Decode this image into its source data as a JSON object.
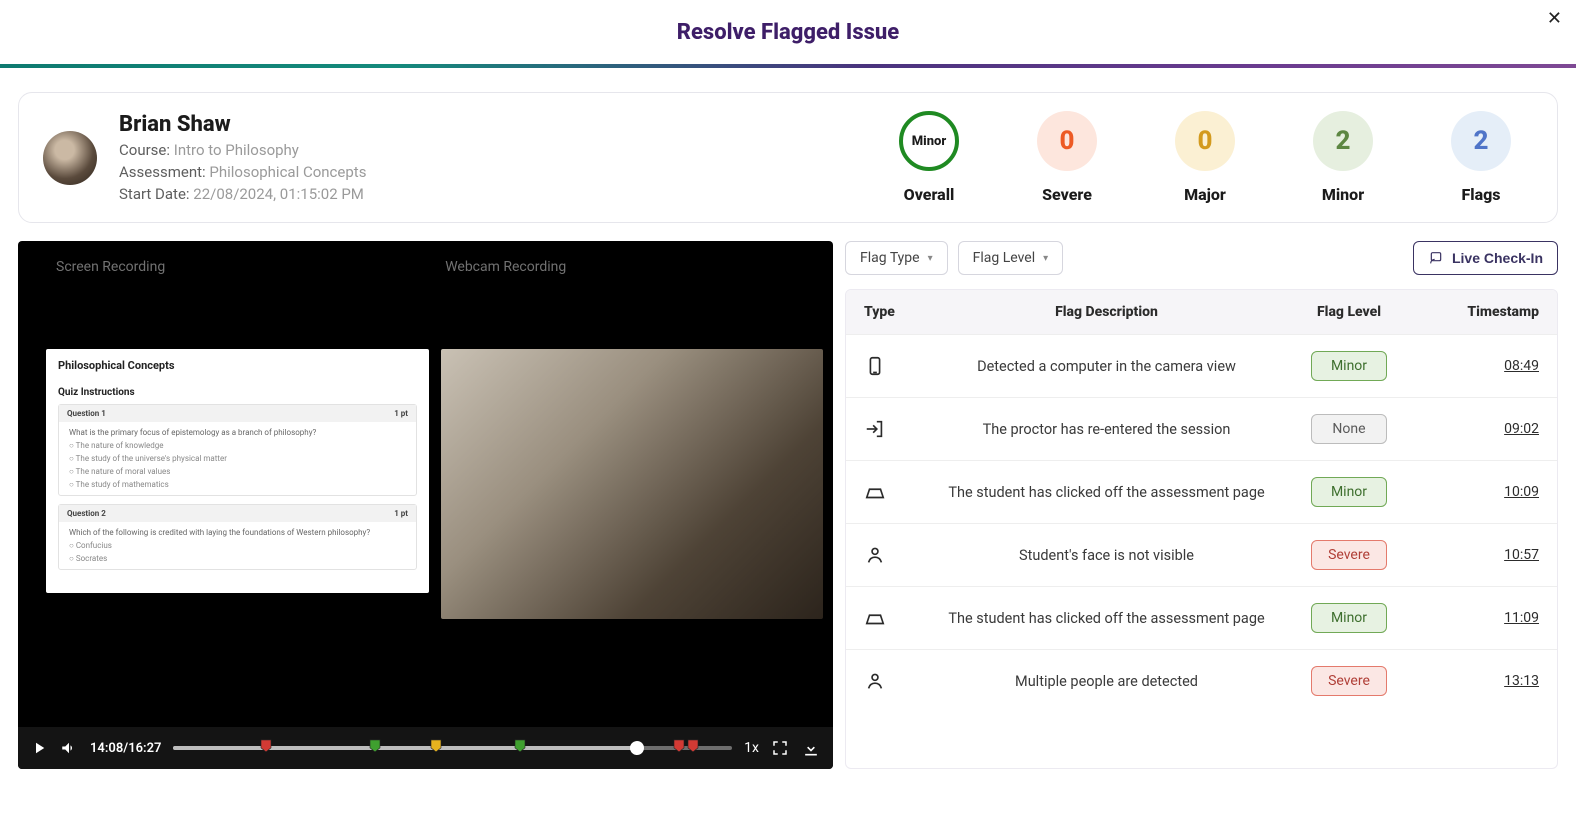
{
  "header": {
    "title": "Resolve Flagged Issue"
  },
  "student": {
    "name": "Brian Shaw",
    "course_label": "Course:",
    "course_value": "Intro to Philosophy",
    "assessment_label": "Assessment:",
    "assessment_value": "Philosophical Concepts",
    "start_label": "Start Date:",
    "start_value": "22/08/2024, 01:15:02 PM"
  },
  "stats": {
    "overall": {
      "text": "Minor",
      "label": "Overall"
    },
    "severe": {
      "value": "0",
      "label": "Severe"
    },
    "major": {
      "value": "0",
      "label": "Major"
    },
    "minor": {
      "value": "2",
      "label": "Minor"
    },
    "flags": {
      "value": "2",
      "label": "Flags"
    }
  },
  "video": {
    "screen_label": "Screen Recording",
    "webcam_label": "Webcam Recording",
    "quiz_title": "Philosophical Concepts",
    "quiz_instr": "Quiz Instructions",
    "q1": "Question 1",
    "q2": "Question 2",
    "pts": "1 pt",
    "time": "14:08/16:27",
    "speed": "1x",
    "markers": [
      {
        "pct": 16.5,
        "color": "#d23a34"
      },
      {
        "pct": 36.0,
        "color": "#3fa02f"
      },
      {
        "pct": 47.0,
        "color": "#e6b21f"
      },
      {
        "pct": 62.0,
        "color": "#3fa02f"
      },
      {
        "pct": 90.5,
        "color": "#d23a34"
      },
      {
        "pct": 93.0,
        "color": "#d23a34"
      }
    ]
  },
  "filters": {
    "type_label": "Flag Type",
    "level_label": "Flag Level",
    "live_label": "Live Check-In"
  },
  "table": {
    "headers": {
      "type": "Type",
      "desc": "Flag Description",
      "level": "Flag Level",
      "ts": "Timestamp"
    },
    "rows": [
      {
        "icon": "device",
        "desc": "Detected a computer in the camera view",
        "level": "Minor",
        "level_cls": "minor",
        "ts": "08:49"
      },
      {
        "icon": "enter",
        "desc": "The proctor has re-entered the session",
        "level": "None",
        "level_cls": "none",
        "ts": "09:02"
      },
      {
        "icon": "tabs",
        "desc": "The student has clicked off the assessment page",
        "level": "Minor",
        "level_cls": "minor",
        "ts": "10:09"
      },
      {
        "icon": "person",
        "desc": "Student's face is not visible",
        "level": "Severe",
        "level_cls": "severe",
        "ts": "10:57"
      },
      {
        "icon": "tabs",
        "desc": "The student has clicked off the assessment page",
        "level": "Minor",
        "level_cls": "minor",
        "ts": "11:09"
      },
      {
        "icon": "person",
        "desc": "Multiple people are detected",
        "level": "Severe",
        "level_cls": "severe",
        "ts": "13:13"
      }
    ]
  }
}
